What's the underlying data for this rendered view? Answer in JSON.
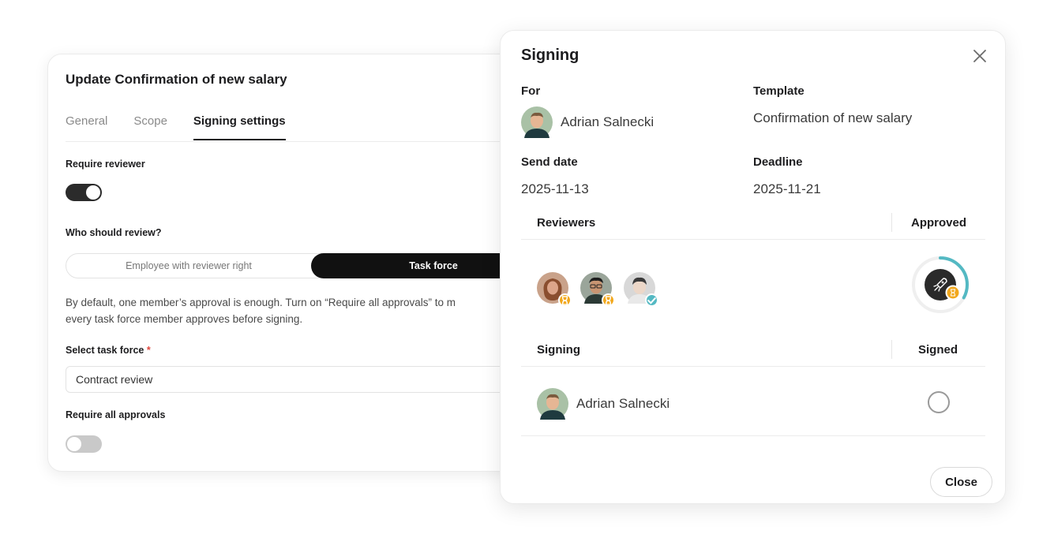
{
  "back_card": {
    "title": "Update Confirmation of new salary",
    "tabs": [
      {
        "label": "General",
        "active": false
      },
      {
        "label": "Scope",
        "active": false
      },
      {
        "label": "Signing settings",
        "active": true
      }
    ],
    "require_reviewer_label": "Require reviewer",
    "require_reviewer_on": true,
    "who_review_label": "Who should review?",
    "review_options": [
      "Employee with reviewer right",
      "Task force"
    ],
    "review_selected": "Task force",
    "helper_line1": "By default, one member’s approval is enough. Turn on “Require all approvals” to m",
    "helper_line2": "every task force member approves before signing.",
    "select_task_force_label": "Select task force",
    "required_marker": "*",
    "task_force_value": "Contract review",
    "require_all_label": "Require all approvals",
    "require_all_on": false
  },
  "modal": {
    "title": "Signing",
    "for_label": "For",
    "for_person": "Adrian Salnecki",
    "template_label": "Template",
    "template_value": "Confirmation of new salary",
    "send_date_label": "Send date",
    "send_date": "2025-11-13",
    "deadline_label": "Deadline",
    "deadline": "2025-11-21",
    "reviewers_header": "Reviewers",
    "approved_header": "Approved",
    "reviewers": [
      {
        "avatar": "woman-avatar",
        "status": "pending"
      },
      {
        "avatar": "man-glasses-avatar",
        "status": "pending"
      },
      {
        "avatar": "person-avatar",
        "status": "approved"
      }
    ],
    "approval_progress": 0.33,
    "signing_header": "Signing",
    "signed_header": "Signed",
    "signers": [
      {
        "name": "Adrian Salnecki",
        "signed": false
      }
    ],
    "close_button": "Close"
  },
  "colors": {
    "accent_teal": "#54b9c3",
    "pending_orange": "#f2a81d",
    "dark": "#111111"
  }
}
